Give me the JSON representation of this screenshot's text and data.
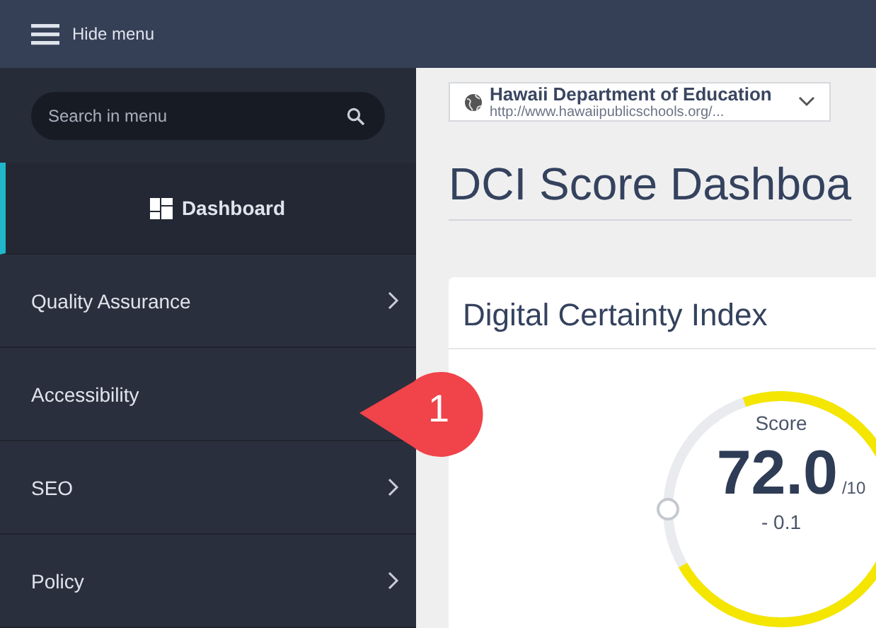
{
  "topbar": {
    "menu_toggle": "Hide menu"
  },
  "sidebar": {
    "search": {
      "placeholder": "Search in menu"
    },
    "items": [
      {
        "label": "Dashboard",
        "kind": "home",
        "selected": true,
        "has_submenu": false
      },
      {
        "label": "Quality Assurance",
        "kind": "link",
        "selected": false,
        "has_submenu": true
      },
      {
        "label": "Accessibility",
        "kind": "link",
        "selected": false,
        "has_submenu": false
      },
      {
        "label": "SEO",
        "kind": "link",
        "selected": false,
        "has_submenu": true
      },
      {
        "label": "Policy",
        "kind": "link",
        "selected": false,
        "has_submenu": true
      }
    ]
  },
  "site_selector": {
    "name": "Hawaii Department of Education",
    "url": "http://www.hawaiipublicschools.org/..."
  },
  "page_title": "DCI Score Dashboa",
  "card": {
    "title": "Digital Certainty Index",
    "gauge": {
      "label": "Score",
      "value": "72.0",
      "max": "/10",
      "change": "- 0.1"
    }
  },
  "callout": {
    "number": "1"
  }
}
